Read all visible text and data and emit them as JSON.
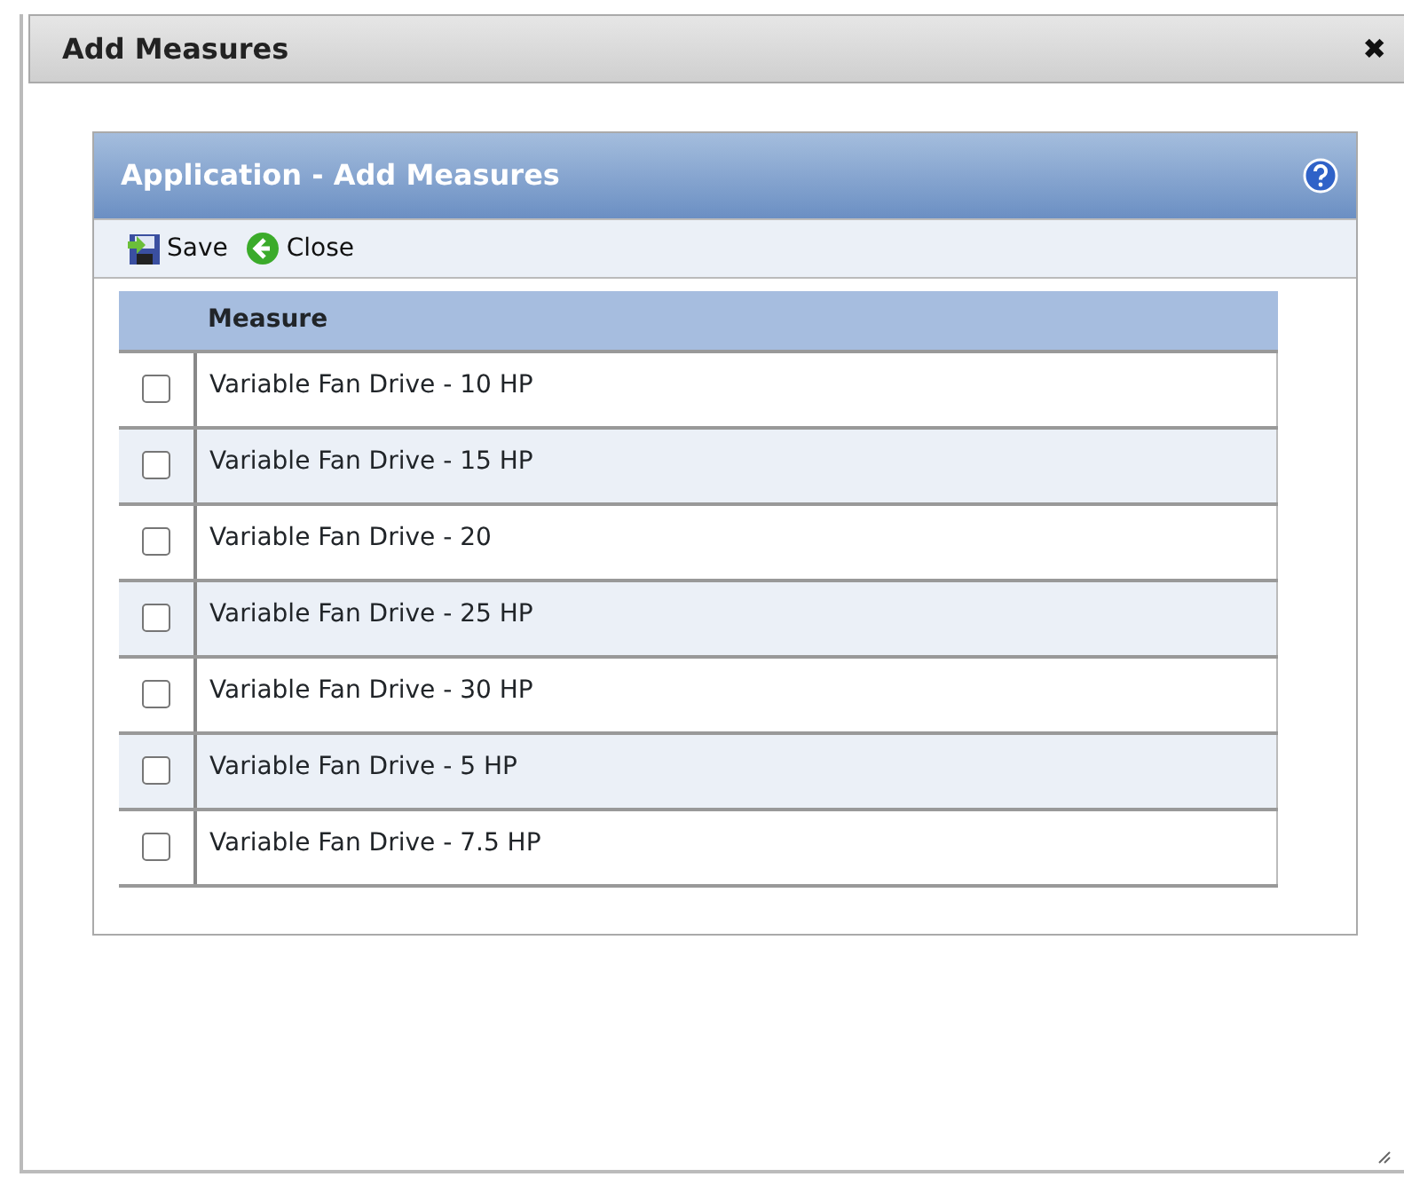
{
  "dialog": {
    "title": "Add Measures",
    "close": "✖"
  },
  "panel": {
    "title": "Application - Add  Measures"
  },
  "toolbar": [
    {
      "label": "Save",
      "kind": "save"
    },
    {
      "label": "Close",
      "kind": "close"
    }
  ],
  "table": {
    "columns": [
      "Measure"
    ],
    "rows": [
      {
        "measure": "Variable Fan Drive - 10 HP",
        "checked": false
      },
      {
        "measure": "Variable Fan Drive - 15 HP",
        "checked": false
      },
      {
        "measure": "Variable Fan Drive - 20",
        "checked": false
      },
      {
        "measure": "Variable Fan Drive - 25 HP",
        "checked": false
      },
      {
        "measure": "Variable Fan Drive - 30 HP",
        "checked": false
      },
      {
        "measure": "Variable Fan Drive - 5 HP",
        "checked": false
      },
      {
        "measure": "Variable Fan Drive - 7.5 HP",
        "checked": false
      }
    ]
  }
}
